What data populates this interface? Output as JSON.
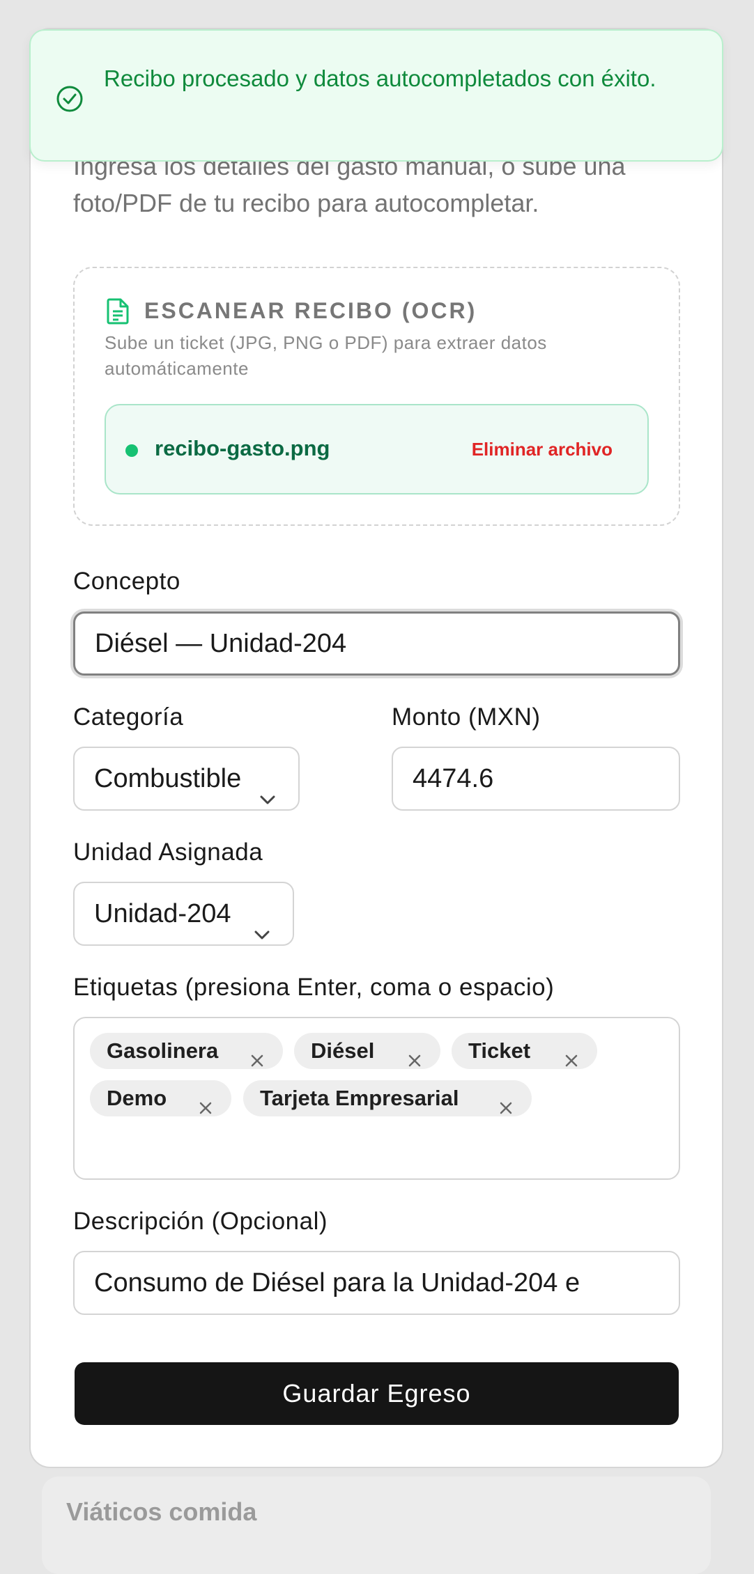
{
  "toast": {
    "message": "Recibo procesado y datos autocompletados con éxito."
  },
  "intro": {
    "text": "Ingresa los detalles del gasto manual, o sube una foto/PDF de tu recibo para autocompletar."
  },
  "ocr": {
    "title": "ESCANEAR RECIBO (OCR)",
    "subtitle": "Sube un ticket (JPG, PNG o PDF) para extraer datos automáticamente",
    "file_name": "recibo-gasto.png",
    "remove_label": "Eliminar archivo",
    "accent_color": "#16c172",
    "remove_color": "#e02525"
  },
  "form": {
    "concept": {
      "label": "Concepto",
      "value": "Diésel — Unidad-204"
    },
    "category": {
      "label": "Categoría",
      "value": "Combustible"
    },
    "amount": {
      "label": "Monto (MXN)",
      "value": "4474.6"
    },
    "unit": {
      "label": "Unidad Asignada",
      "value": "Unidad-204"
    },
    "tags": {
      "label": "Etiquetas (presiona Enter, coma o espacio)",
      "items": [
        "Gasolinera",
        "Diésel",
        "Ticket",
        "Demo",
        "Tarjeta Empresarial"
      ]
    },
    "description": {
      "label": "Descripción (Opcional)",
      "value": "Consumo de Diésel para la Unidad-204 e"
    },
    "submit_label": "Guardar Egreso"
  },
  "background": {
    "next_item_title": "Viáticos comida"
  }
}
